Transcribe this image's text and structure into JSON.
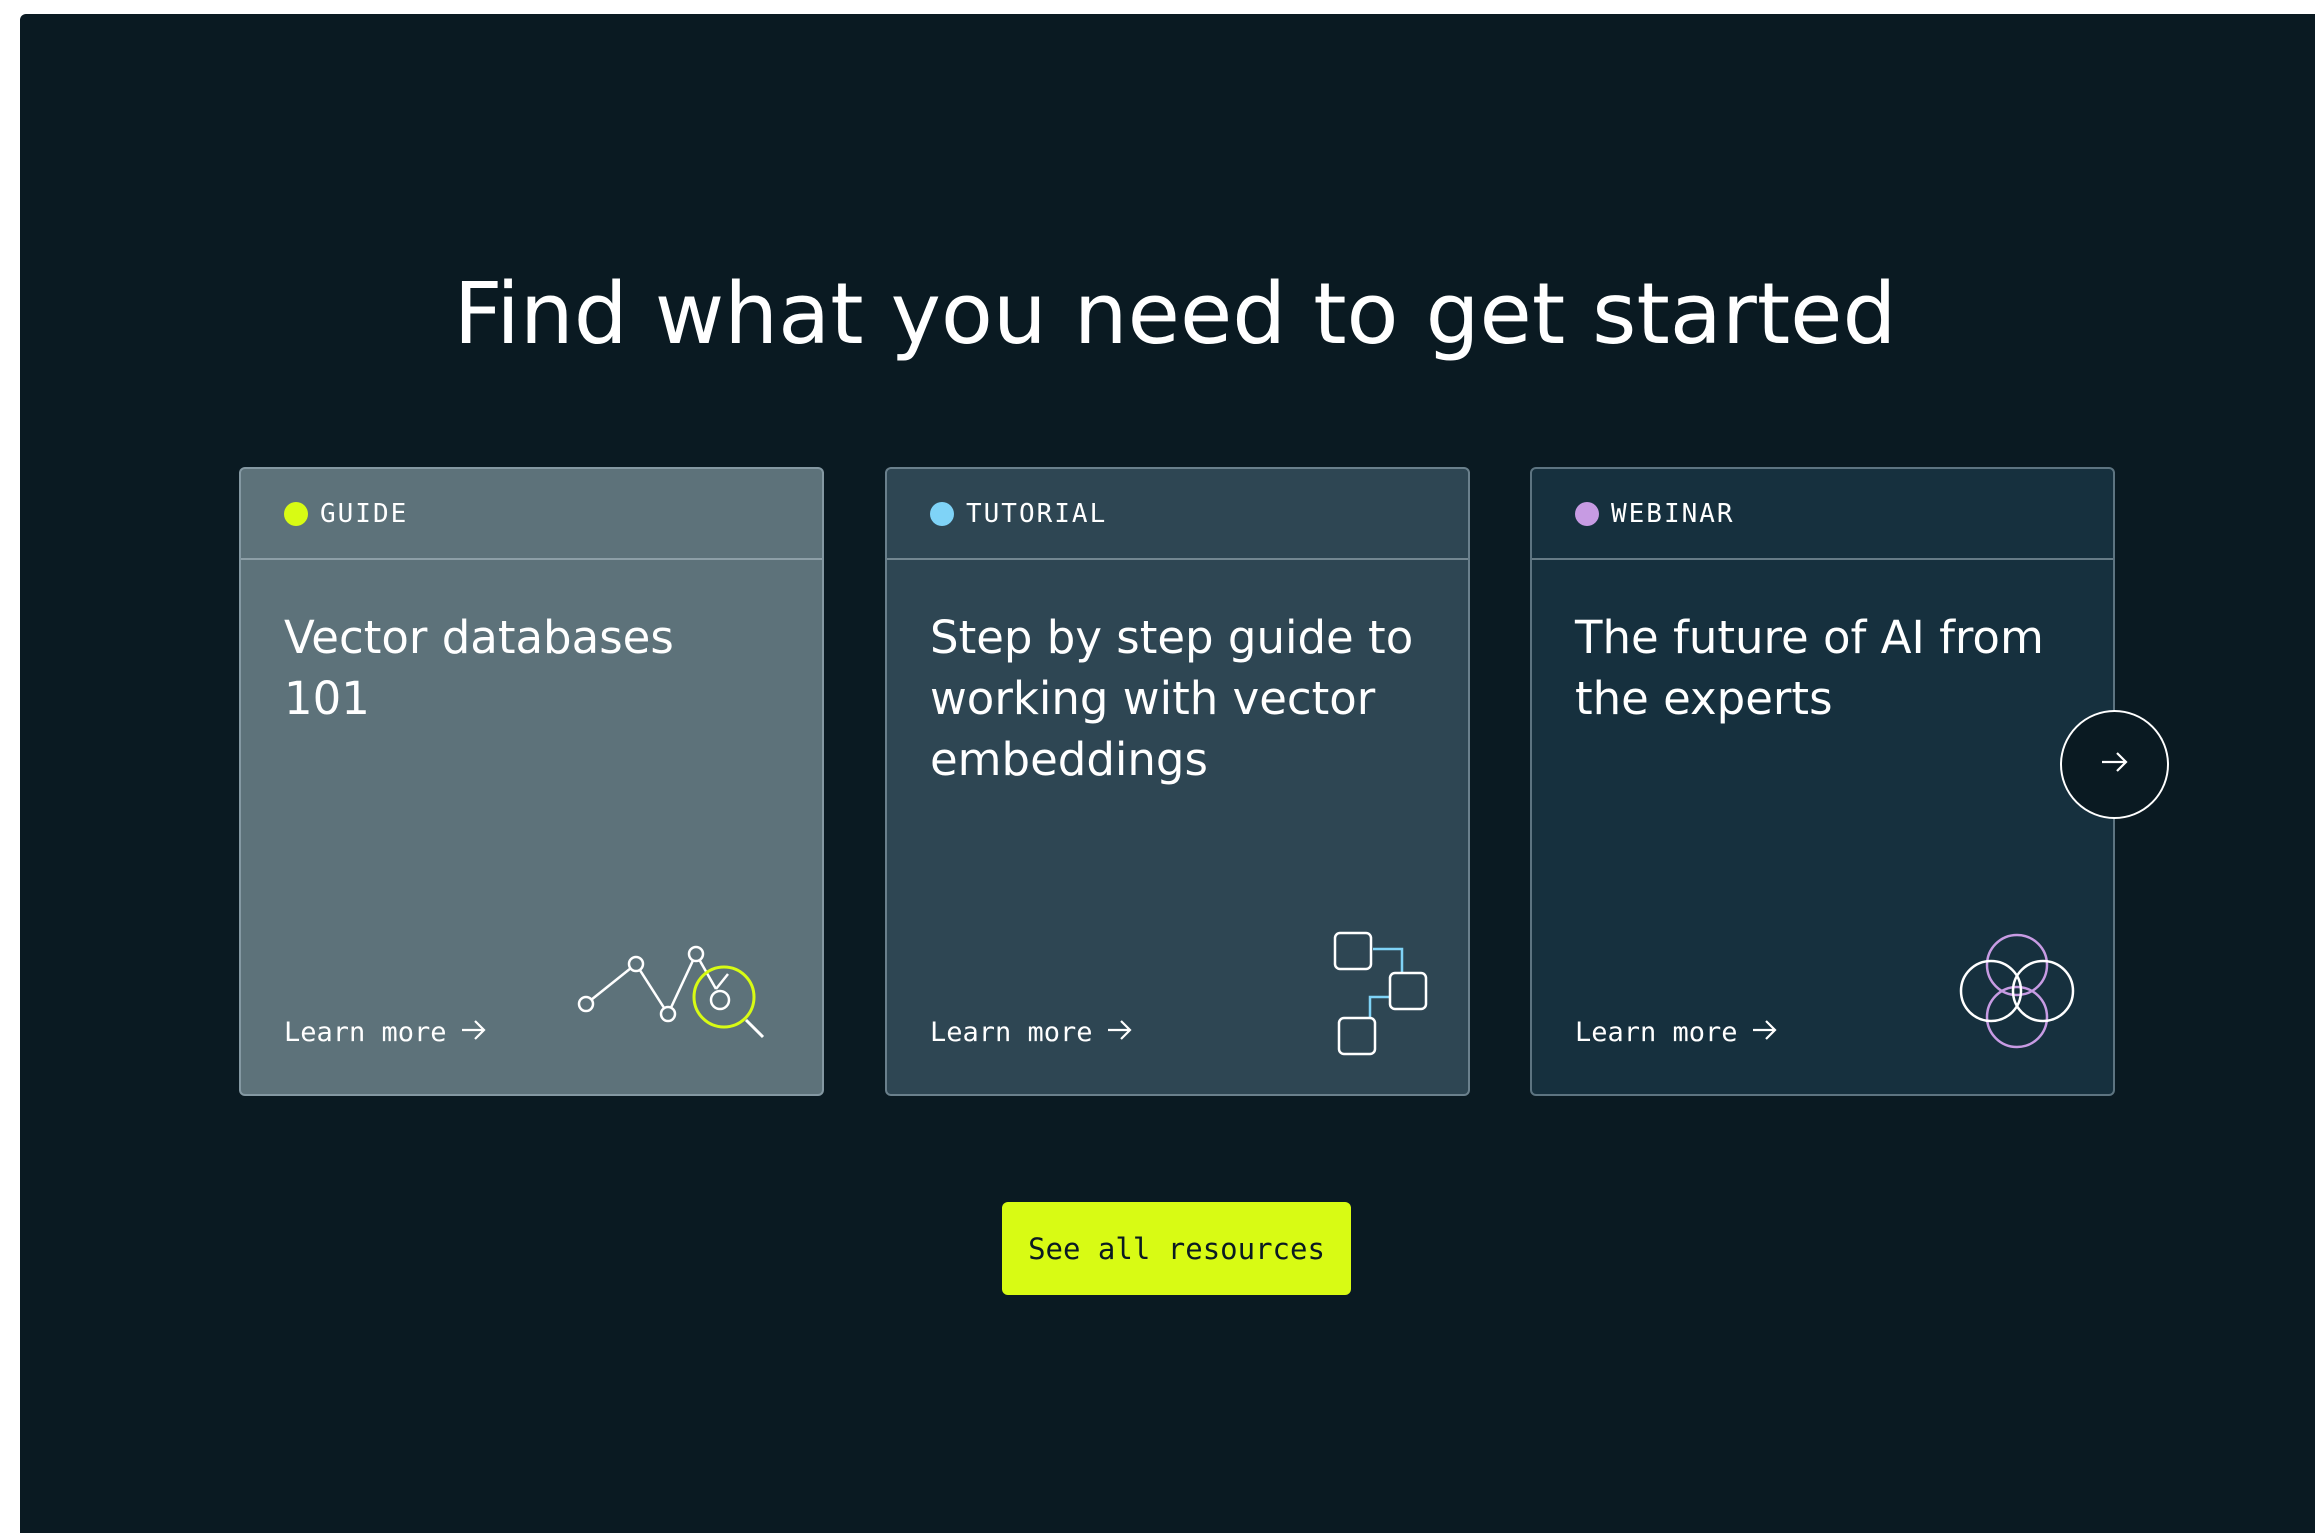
{
  "section": {
    "headline": "Find what you need to get started"
  },
  "cards": [
    {
      "tag": "GUIDE",
      "tag_color": "#d8fb14",
      "title": "Vector databases 101",
      "link": "Learn more",
      "icon": "line-chart-search-icon"
    },
    {
      "tag": "TUTORIAL",
      "tag_color": "#7fd3f7",
      "title": "Step by step guide to working with vector embeddings",
      "link": "Learn more",
      "icon": "connected-nodes-icon"
    },
    {
      "tag": "WEBINAR",
      "tag_color": "#c79be3",
      "title": "The future of AI from the experts",
      "link": "Learn more",
      "icon": "overlapping-circles-icon"
    }
  ],
  "carousel": {
    "next_icon": "arrow-right-icon"
  },
  "cta": {
    "label": "See all resources",
    "color": "#d8fb14"
  }
}
